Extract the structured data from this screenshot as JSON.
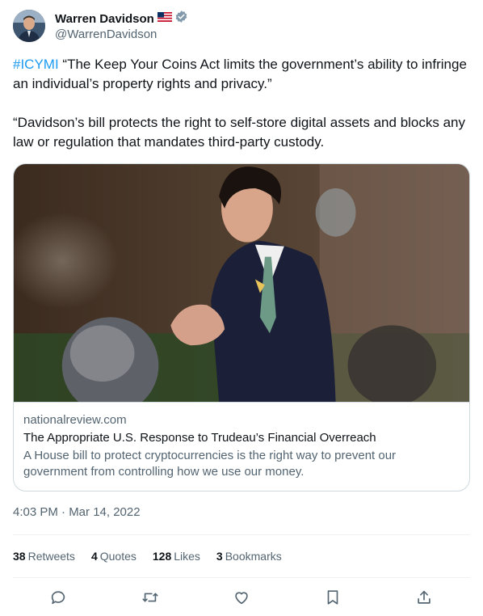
{
  "author": {
    "display_name": "Warren Davidson",
    "handle": "@WarrenDavidson",
    "flag_icon": "us-flag-icon",
    "verified_icon": "verified-badge-icon"
  },
  "tweet": {
    "hashtag": "#ICYMI",
    "line1_rest": " “The Keep Your Coins Act limits the government’s ability to infringe an individual’s property rights and privacy.”",
    "line2": "“Davidson’s bill protects the right to self-store digital assets and blocks any law or regulation that mandates third-party custody."
  },
  "card": {
    "image_icon": "article-photo",
    "domain": "nationalreview.com",
    "title": "The Appropriate U.S. Response to Trudeau’s Financial Overreach",
    "description": "A House bill to protect cryptocurrencies is the right way to prevent our government from controlling how we use our money."
  },
  "timestamp": "4:03 PM · Mar 14, 2022",
  "stats": {
    "retweets_count": "38",
    "retweets_label": "Retweets",
    "quotes_count": "4",
    "quotes_label": "Quotes",
    "likes_count": "128",
    "likes_label": "Likes",
    "bookmarks_count": "3",
    "bookmarks_label": "Bookmarks"
  },
  "actions": [
    "reply-icon",
    "retweet-icon",
    "like-icon",
    "bookmark-icon",
    "share-icon"
  ],
  "colors": {
    "accent": "#1d9bf0",
    "secondary_text": "#536471",
    "border": "#cfd9de"
  }
}
